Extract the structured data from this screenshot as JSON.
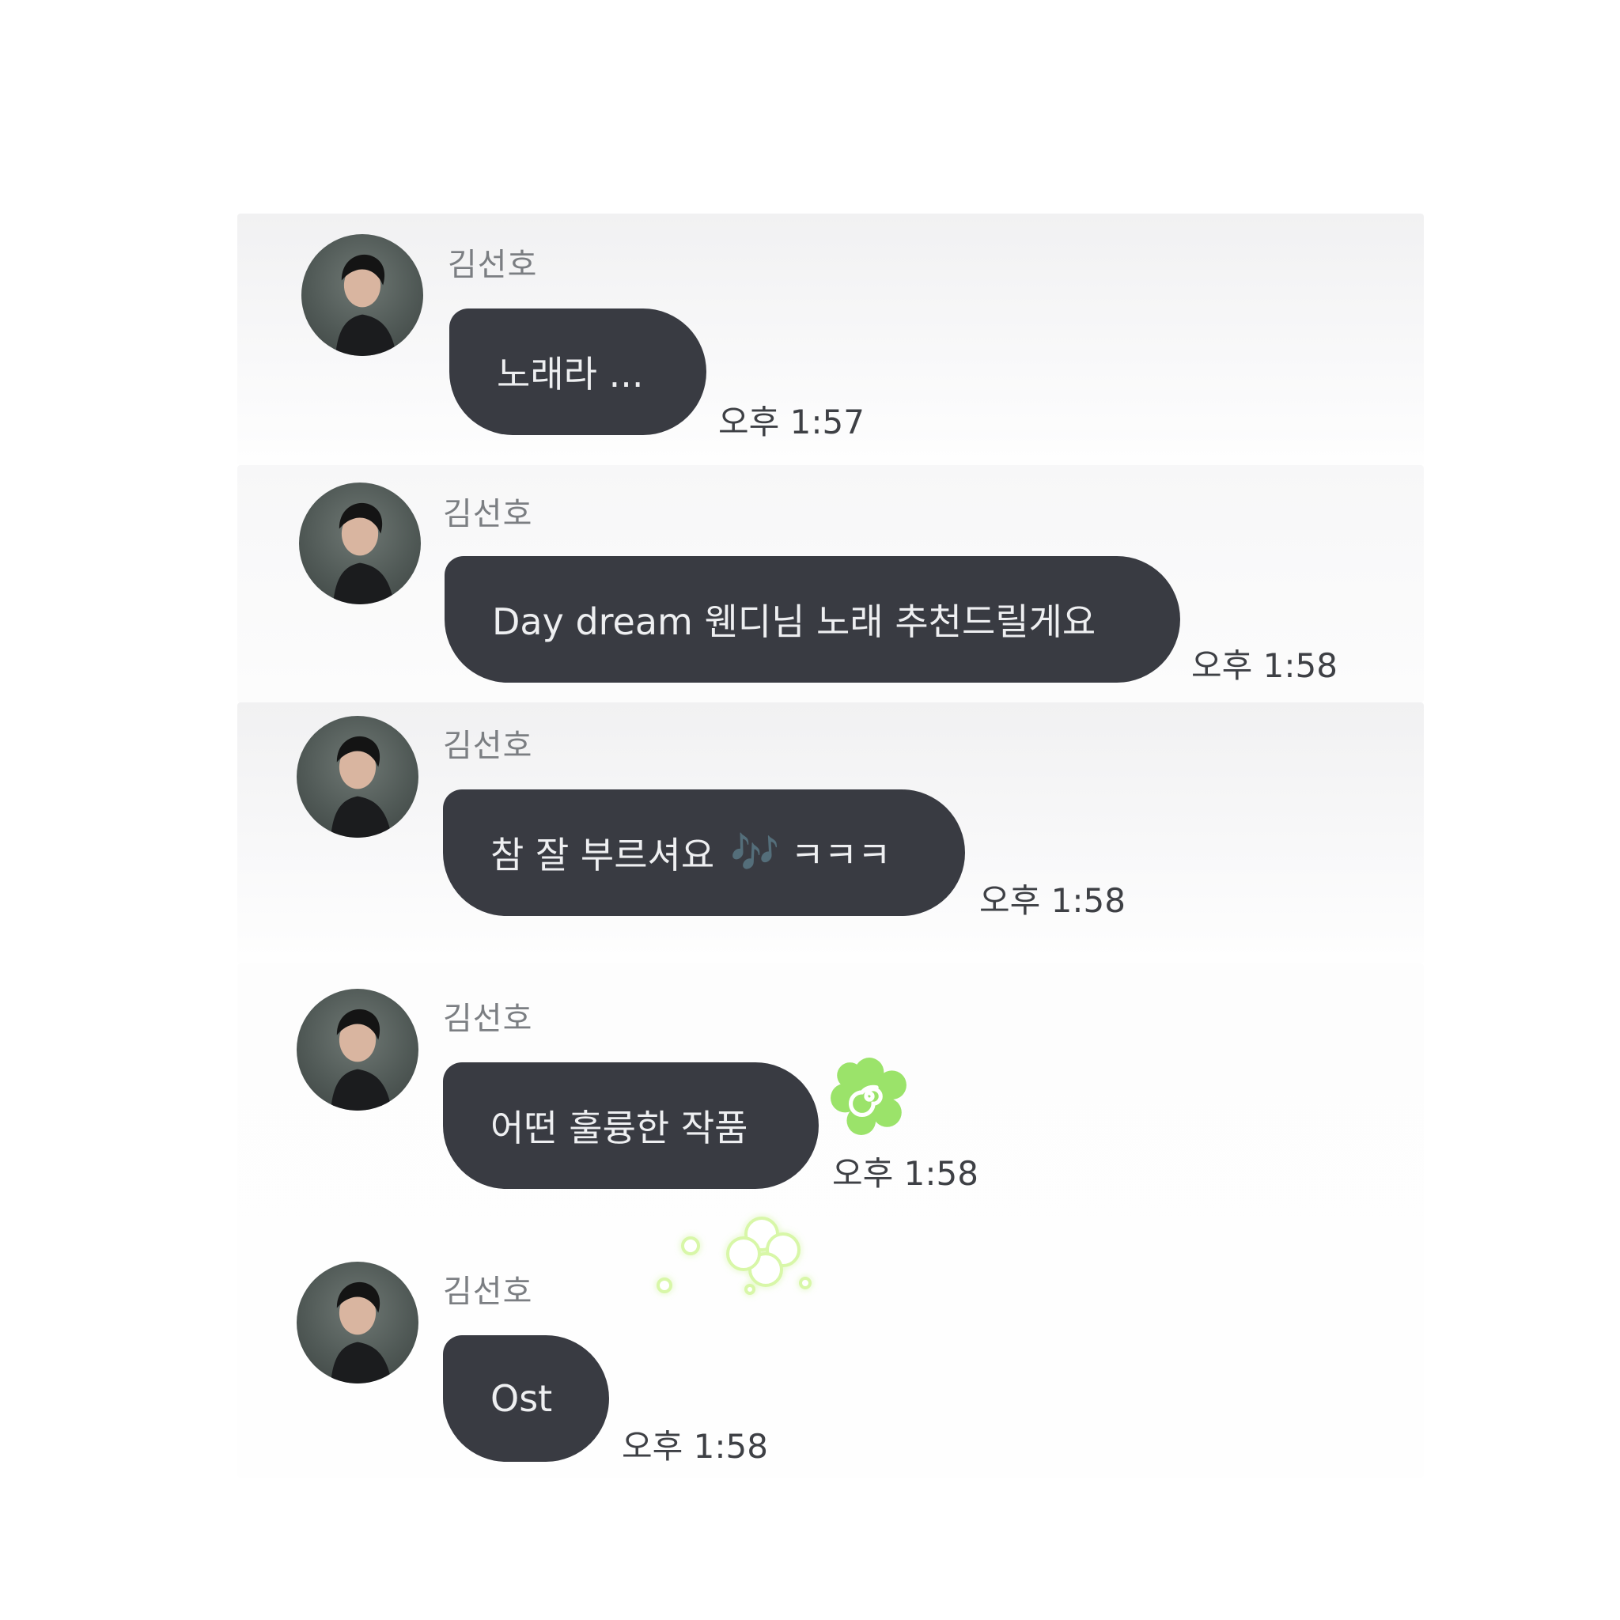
{
  "messages": [
    {
      "sender": "김선호",
      "text": "노래라 ...",
      "time": "오후 1:57"
    },
    {
      "sender": "김선호",
      "text": "Day dream 웬디님 노래 추천드릴게요",
      "time": "오후 1:58"
    },
    {
      "sender": "김선호",
      "text_before": "참 잘 부르셔요",
      "emoji": "🎶",
      "text_after": "ㅋㅋㅋ",
      "time": "오후 1:58"
    },
    {
      "sender": "김선호",
      "text": "어떤 훌륭한 작품",
      "time": "오후 1:58"
    },
    {
      "sender": "김선호",
      "text": "Ost",
      "time": "오후 1:58"
    }
  ],
  "stickers": {
    "flower_icon": "green-spiral-flower-sticker",
    "clover_icon": "glowing-clover-sticker",
    "accent": "#9be36a"
  },
  "colors": {
    "bubble": "#393b42",
    "bubble_text": "#eeeff1",
    "name_text": "#7b7e82",
    "time_text": "#3e4045"
  }
}
